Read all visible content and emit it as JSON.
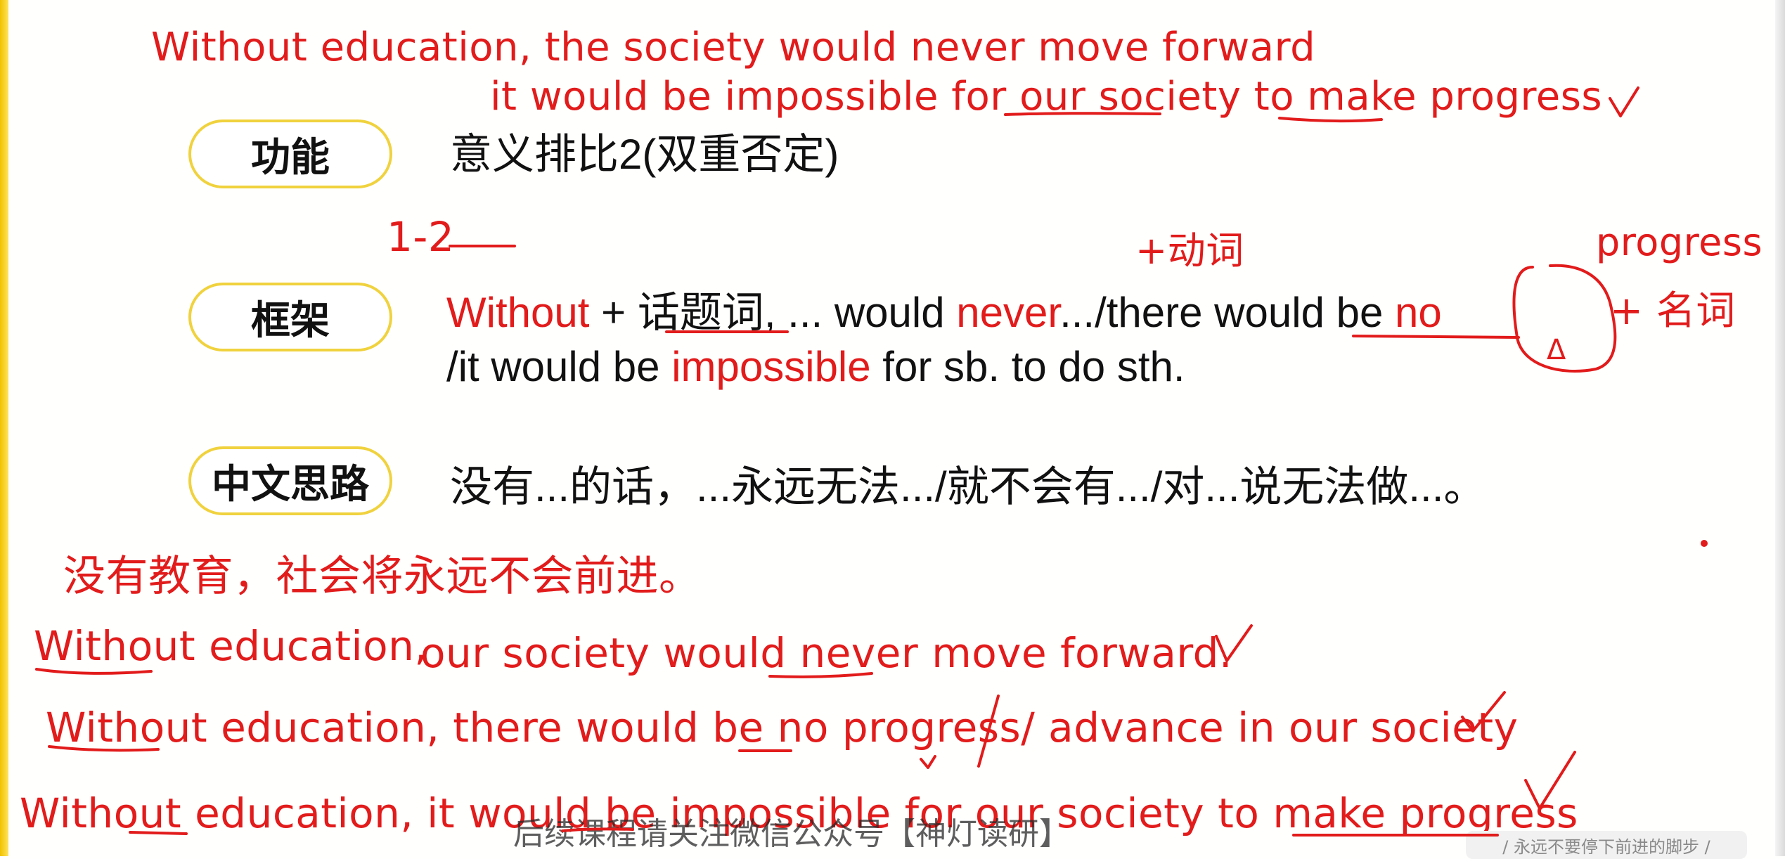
{
  "annotations": {
    "top_line1": "Without education, the society would never move forward",
    "top_line2": "it would be impossible for our society to make progress",
    "one_two": "1-2",
    "plus_verb": "+动词",
    "progress_note": "progress",
    "plus_noun": "+ 名词",
    "triangle": "Δ",
    "cn_sentence": "没有教育，社会将永远不会前进。",
    "ex1_part1": "Without education,",
    "ex1_part2": "our society would never move forward.",
    "ex2": "Without education, there would be no progress/ advance in our society",
    "ex3": "Without education, it would be impossible for our society to make progress"
  },
  "rows": {
    "function": {
      "label": "功能",
      "text": "意义排比2(双重否定)"
    },
    "frame": {
      "label": "框架",
      "l1_without": "Without",
      "l1_plus": " + ",
      "l1_topic": "话题词",
      "l1_mid": ", ... would ",
      "l1_never": "never",
      "l1_rest": ".../there would be ",
      "l1_no": "no",
      "l2_pre": "/it would be ",
      "l2_impossible": "impossible",
      "l2_post": " for sb. to do sth."
    },
    "idea": {
      "label": "中文思路",
      "text": "没有...的话，...永远无法.../就不会有.../对...说无法做...。"
    }
  },
  "watermark": "后续课程请关注微信公众号【神灯读研】",
  "footer": "/ 永远不要停下前进的脚步 /",
  "colors": {
    "ink_red": "#e21b1b",
    "pill_border": "#f0d23e",
    "frame_yellow": "#f2c200"
  },
  "icons": {
    "checkmark": "checkmark-icon"
  }
}
